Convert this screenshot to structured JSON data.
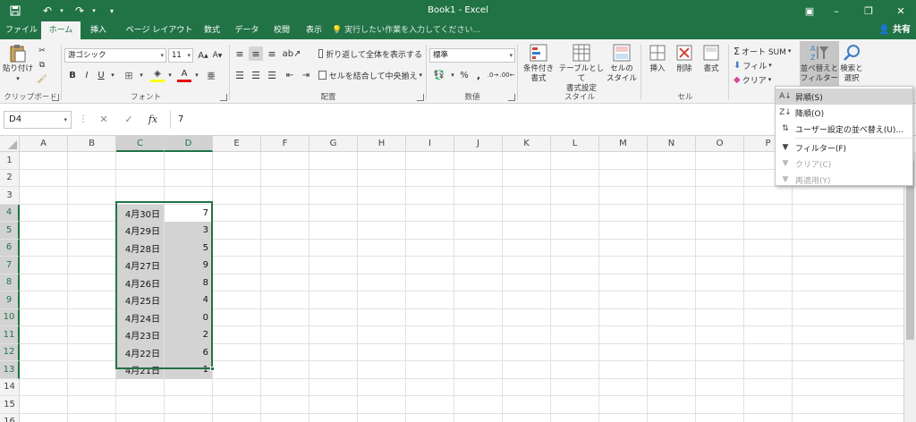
{
  "titlebar": {
    "title": "Book1 - Excel",
    "save_icon": "save-icon",
    "undo_icon": "undo-icon",
    "redo_icon": "redo-icon",
    "qat_icon": "customize-qat-icon"
  },
  "tabs": [
    {
      "label": "ファイル",
      "active": false
    },
    {
      "label": "ホーム",
      "active": true
    },
    {
      "label": "挿入",
      "active": false
    },
    {
      "label": "ページ レイアウト",
      "active": false
    },
    {
      "label": "数式",
      "active": false
    },
    {
      "label": "データ",
      "active": false
    },
    {
      "label": "校閲",
      "active": false
    },
    {
      "label": "表示",
      "active": false
    }
  ],
  "tellme": "実行したい作業を入力してください...",
  "share": "共有",
  "ribbon": {
    "clipboard": {
      "label": "クリップボード",
      "paste": "貼り付け"
    },
    "font": {
      "label": "フォント",
      "name": "游ゴシック",
      "size": "11",
      "bold": "B",
      "italic": "I",
      "underline": "U"
    },
    "alignment": {
      "label": "配置",
      "wrap": "折り返して全体を表示する",
      "merge": "セルを結合して中央揃え"
    },
    "number": {
      "label": "数値",
      "format": "標準",
      "percent": "%",
      "comma": ","
    },
    "styles": {
      "label": "スタイル",
      "conditional": "条件付き\n書式",
      "table": "テーブルとして\n書式設定",
      "cell": "セルの\nスタイル"
    },
    "cells": {
      "label": "セル",
      "insert": "挿入",
      "delete": "削除",
      "format": "書式"
    },
    "editing": {
      "autosum": "オート SUM",
      "fill": "フィル",
      "clear": "クリア",
      "sort": "並べ替えと\nフィルター",
      "find": "検索と\n選択"
    }
  },
  "formula": {
    "namebox": "D4",
    "value": "7",
    "fx": "fx"
  },
  "columns": [
    "A",
    "B",
    "C",
    "D",
    "E",
    "F",
    "G",
    "H",
    "I",
    "J",
    "K",
    "L",
    "M",
    "N",
    "O",
    "P"
  ],
  "rows": [
    "1",
    "2",
    "3",
    "4",
    "5",
    "6",
    "7",
    "8",
    "9",
    "10",
    "11",
    "12",
    "13",
    "14",
    "15",
    "16"
  ],
  "data": {
    "C": [
      "4月30日",
      "4月29日",
      "4月28日",
      "4月27日",
      "4月26日",
      "4月25日",
      "4月24日",
      "4月23日",
      "4月22日",
      "4月21日"
    ],
    "D": [
      "7",
      "3",
      "5",
      "9",
      "8",
      "4",
      "0",
      "2",
      "6",
      "1"
    ]
  },
  "menu": {
    "items": [
      {
        "label": "昇順(S)",
        "icon": "sort-ascending-icon",
        "enabled": true,
        "hover": true
      },
      {
        "label": "降順(O)",
        "icon": "sort-descending-icon",
        "enabled": true
      },
      {
        "label": "ユーザー設定の並べ替え(U)...",
        "icon": "custom-sort-icon",
        "enabled": true
      },
      {
        "label": "フィルター(F)",
        "icon": "filter-icon",
        "enabled": true
      },
      {
        "label": "クリア(C)",
        "icon": "clear-filter-icon",
        "enabled": false
      },
      {
        "label": "再適用(Y)",
        "icon": "reapply-filter-icon",
        "enabled": false
      }
    ]
  },
  "colors": {
    "accent": "#217346",
    "selection": "#d3d3d3"
  }
}
